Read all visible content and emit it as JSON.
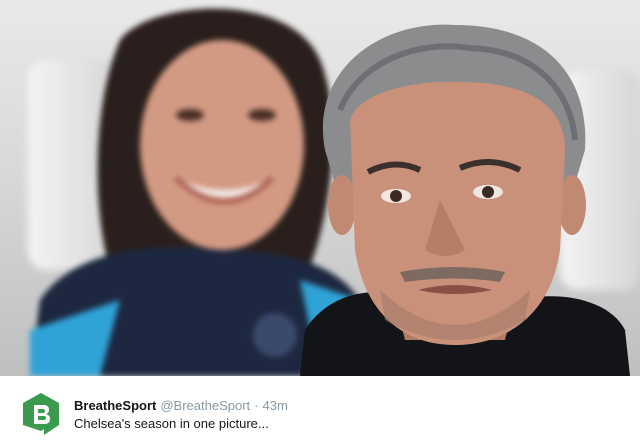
{
  "tweet": {
    "display_name": "BreatheSport",
    "handle": "@BreatheSport",
    "separator": "·",
    "time": "43m",
    "text": "Chelsea's season in one picture..."
  },
  "avatar": {
    "icon": "breathe-sport-logo-icon",
    "color": "#3a9b4f"
  },
  "photo": {
    "icon": "photo-of-two-people-image"
  }
}
